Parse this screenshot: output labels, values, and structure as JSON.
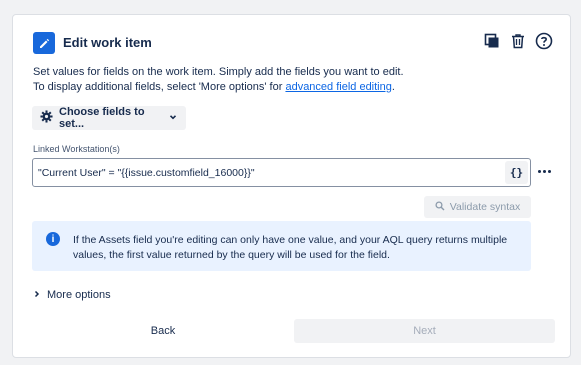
{
  "header": {
    "title": "Edit work item",
    "icons": [
      "pencil-icon",
      "duplicate-icon",
      "trash-icon",
      "help-icon"
    ]
  },
  "description": {
    "line1": "Set values for fields on the work item. Simply add the fields you want to edit.",
    "line2_prefix": "To display additional fields, select 'More options' for ",
    "line2_link": "advanced field editing",
    "line2_suffix": "."
  },
  "choose_fields": {
    "label": "Choose fields to set..."
  },
  "field": {
    "label": "Linked Workstation(s)",
    "value": "\"Current User\" = \"{{issue.customfield_16000}}\"",
    "json_button": "{}"
  },
  "validate": {
    "label": "Validate syntax"
  },
  "info": {
    "text": "If the Assets field you're editing can only have one value, and your AQL query returns multiple values, the first value returned by the query will be used for the field."
  },
  "more_options": {
    "label": "More options"
  },
  "footer": {
    "back_label": "Back",
    "next_label": "Next"
  },
  "colors": {
    "accent": "#1868db",
    "link": "#0c66e4",
    "info_bg": "#e9f2ff",
    "button_bg": "#f1f2f4"
  }
}
